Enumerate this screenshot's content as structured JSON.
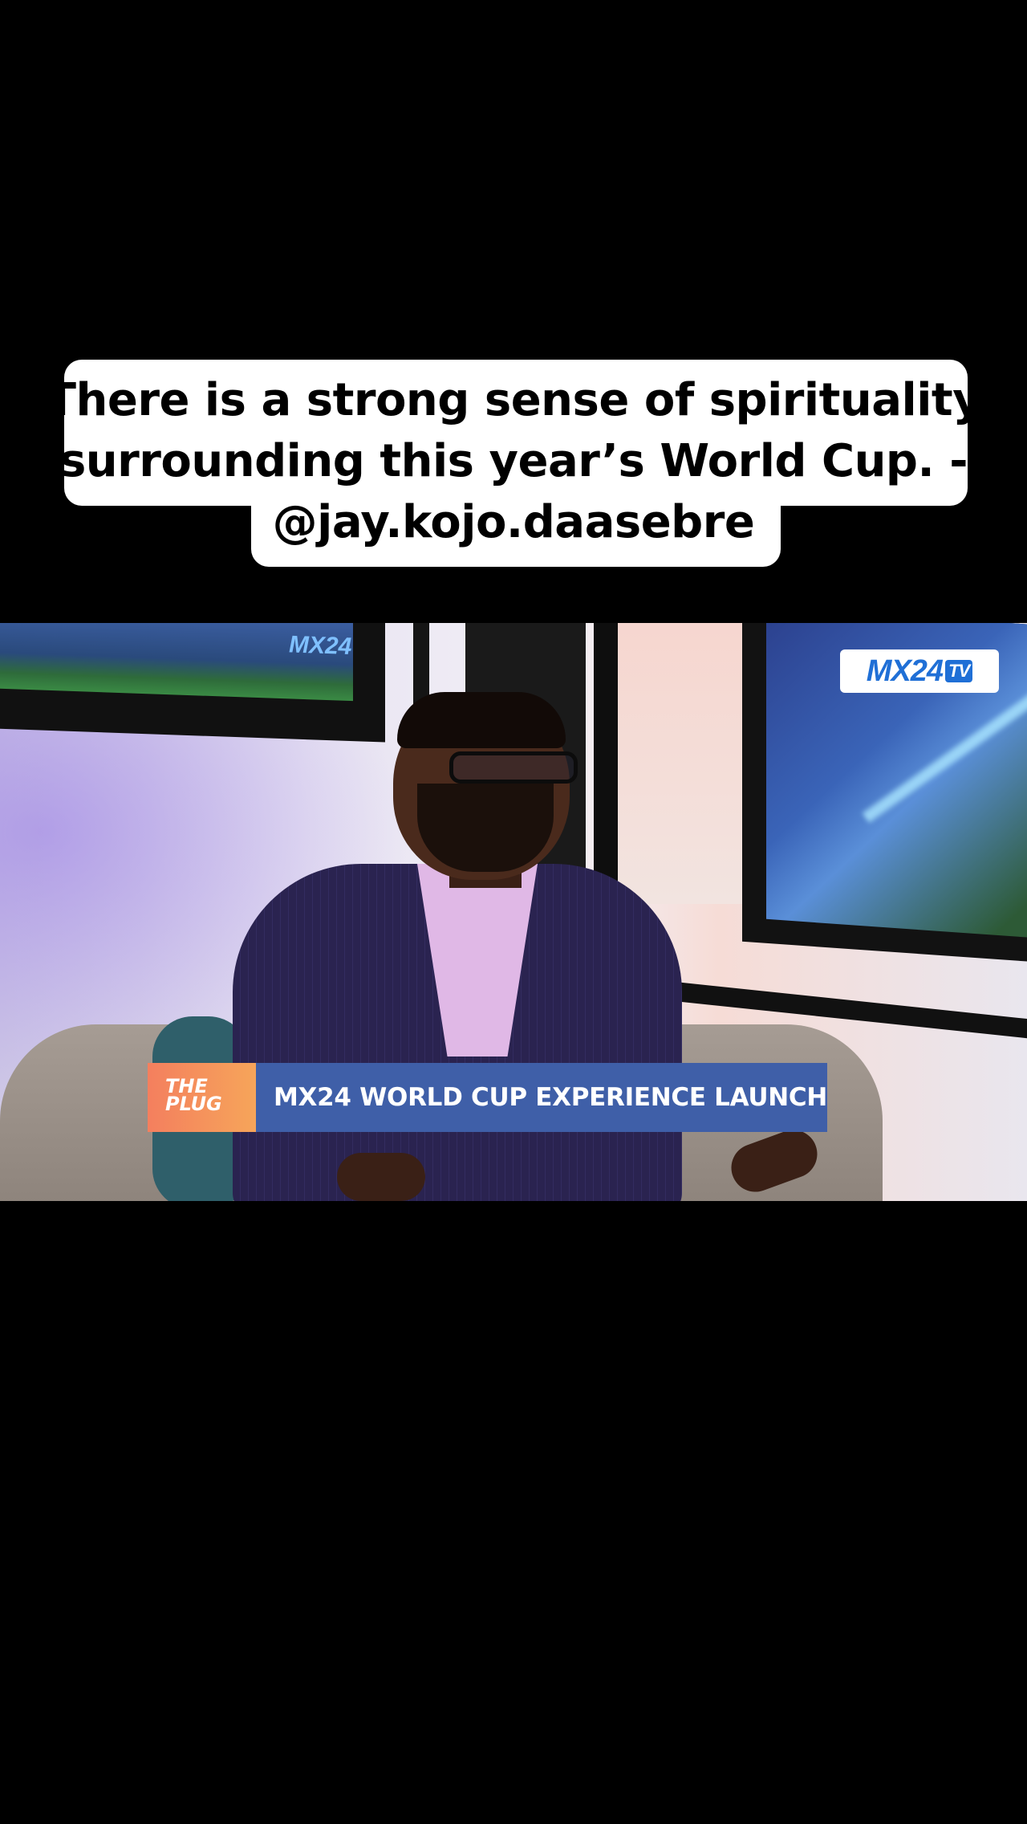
{
  "caption": {
    "line1": "There is a strong sense of spirituality",
    "line2": "surrounding this year’s World Cup. -",
    "line3": "@jay.kojo.daasebre"
  },
  "video": {
    "channel_logo_main": "MX24",
    "channel_logo_suffix": "TV",
    "background_screen_logo": "MX24",
    "lower_third": {
      "show_tag": "THE PLUG",
      "headline": "MX24 WORLD CUP EXPERIENCE LAUNCH"
    }
  },
  "colors": {
    "background": "#000000",
    "caption_bg": "#ffffff",
    "lower_third_tag": "#f47f5e",
    "lower_third_bar": "#3f5fa8",
    "logo_blue": "#1f6fd6"
  }
}
